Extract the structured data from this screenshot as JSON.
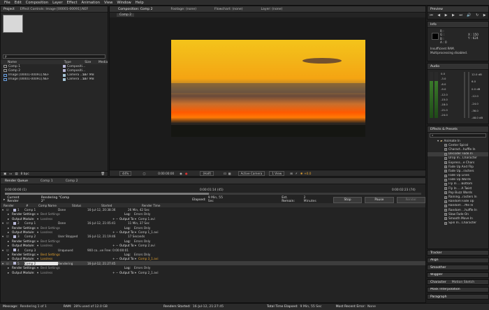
{
  "menu": [
    "File",
    "Edit",
    "Composition",
    "Layer",
    "Effect",
    "Animation",
    "View",
    "Window",
    "Help"
  ],
  "project": {
    "tabs": [
      "Project",
      "Effect Controls: Image [00001-00091].NEF"
    ],
    "columns": [
      "Name",
      "Type",
      "Size",
      "Media"
    ],
    "items": [
      {
        "name": "Comp 1",
        "type": "Compositi...",
        "size": "",
        "media": ""
      },
      {
        "name": "Comp 2",
        "type": "Compositi...",
        "size": "",
        "media": ""
      },
      {
        "name": "Image [00001-00091].NEF",
        "type": "Camera ...ce",
        "size": "517 MB",
        "media": ""
      },
      {
        "name": "Image [00001-00091].NEF",
        "type": "Camera ...ce",
        "size": "517 MB",
        "media": ""
      }
    ],
    "bpc": "8 bpc",
    "search_placeholder": "ρ"
  },
  "viewer": {
    "tabs": [
      "Composition: Comp 2",
      "Footage: (none)",
      "Flowchart: (none)",
      "Layer: (none)"
    ],
    "subtab": "Comp 2",
    "zoom": "44%",
    "timecode": "0:00:00:00",
    "resolution": "(Half)",
    "camera": "Active Camera",
    "view": "1 View",
    "exposure": "+0.0",
    "image_colors": {
      "sky_top": "#f2c21a",
      "sky_mid": "#f5a210",
      "cloud": "#6a4a3a",
      "band": "#ff5a00",
      "ground": "#1d1f1a"
    }
  },
  "right": {
    "preview_tab": "Preview",
    "info_tab": "Info",
    "info_values": {
      "r": "R :",
      "g": "G :",
      "b": "B :",
      "a": "A : 0",
      "x": "X : 150",
      "y": "Y : 624"
    },
    "info_msg1": "Insufficient RAM.",
    "info_msg2": "Multiprocessing disabled.",
    "audio_tab": "Audio",
    "audio_left": [
      "0.0",
      "-3.0",
      "-6.0",
      "-9.0",
      "-12.0",
      "-15.0",
      "-18.0",
      "-21.0",
      "-24.0"
    ],
    "audio_right": [
      "12.0 dB",
      "6.0",
      "0.0 dB",
      "-12.0",
      "-24.0",
      "-36.0",
      "-48.0 dB"
    ],
    "effects_tab": "Effects & Presets",
    "fx_folder": "Animate In",
    "fx_items": [
      "Center Spiral",
      "Charact...huffle In",
      "Decoder Fade In",
      "Drop In...Character",
      "Express...e Chars",
      "Fade Up And Flip",
      "Fade Up...racters",
      "Fade Up Lines",
      "Fade Up Words",
      "Fly In ... Bottom",
      "Fly In ... A Twist",
      "Pop Buzz Words",
      "Raining...racters In",
      "Random Fade Up",
      "Random ...ffle In",
      "Random ...huffle In",
      "Slow Fade On",
      "Smooth Move In",
      "Spin In...Character"
    ],
    "lower_tabs": [
      "Tracker",
      "Align",
      "Smoother",
      "Wiggler",
      "Character",
      "Motion Sketch",
      "Mask Interpolation",
      "Paragraph"
    ]
  },
  "render": {
    "tabs": [
      "Render Queue",
      "Comp 1",
      "Comp 2"
    ],
    "start_time": "0:00:00:00 (1)",
    "mid_time": "0:00:01:14 (45)",
    "end_time": "0:00:02:23 (74)",
    "current_render_label": "Current Render",
    "rendering_label": "Rendering \"Comp 2\"",
    "elapsed_label": "Elapsed:",
    "elapsed_value": "9 Min, 55 Sec",
    "est_label": "Est. Remain:",
    "est_value": "2 Minutes",
    "stop": "Stop",
    "pause": "Pause",
    "render_btn": "Render",
    "columns": [
      "Render",
      "#",
      "Comp Name",
      "Status",
      "Started",
      "Render Time"
    ],
    "rows": [
      {
        "num": "1",
        "comp": "Comp 1",
        "status": "Done",
        "started": "16-Jul-12, 20:38:36",
        "time": "26 Min, 42 Sec",
        "log": "Errors Only",
        "output": "Comp 1.avi",
        "settings": "Best Settings",
        "module": "Lossless",
        "selected": false
      },
      {
        "num": "2",
        "comp": "Comp 1",
        "status": "Done",
        "started": "16-Jul-12, 21:05:41",
        "time": "11 Min, 37 Sec",
        "log": "Errors Only",
        "output": "Comp 1_1.avi",
        "settings": "Best Settings",
        "module": "Lossless",
        "selected": false
      },
      {
        "num": "3",
        "comp": "Comp 2",
        "status": "User Stopped",
        "started": "16-Jul-12, 21:19:46",
        "time": "17 Seconds",
        "log": "Errors Only",
        "output": "Comp 2.avi",
        "settings": "Best Settings",
        "module": "Lossless",
        "selected": false
      },
      {
        "num": "4",
        "comp": "Comp 3",
        "status": "Unqueued",
        "started": "900 co...ve Free: 0:00:00:01",
        "time": "",
        "log": "Errors Only",
        "output": "Comp 3_1.avi",
        "settings": "Best Settings",
        "module": "Lossless",
        "selected": false
      },
      {
        "num": "5",
        "comp": "Comp 2",
        "status": "Rendering",
        "started": "16-Jul-12, 21:27:45",
        "time": "",
        "log": "Errors Only",
        "output": "Comp 2_1.avi",
        "settings": "Best Settings",
        "module": "Lossless",
        "selected": true
      }
    ],
    "row_labels": {
      "render_settings": "Render Settings:",
      "output_module": "Output Module:",
      "log": "Log:",
      "output_to": "Output To:"
    }
  },
  "status": {
    "message_label": "Message:",
    "message_value": "Rendering 1 of 1",
    "ram_label": "RAM:",
    "ram_value": "28% used of 12.0 GB",
    "started_label": "Renders Started:",
    "started_value": "16-Jul-12, 21:27:45",
    "elapsed_label": "Total Time Elapsed:",
    "elapsed_value": "9 Min, 55 Sec",
    "error_label": "Most Recent Error:",
    "error_value": "None"
  }
}
